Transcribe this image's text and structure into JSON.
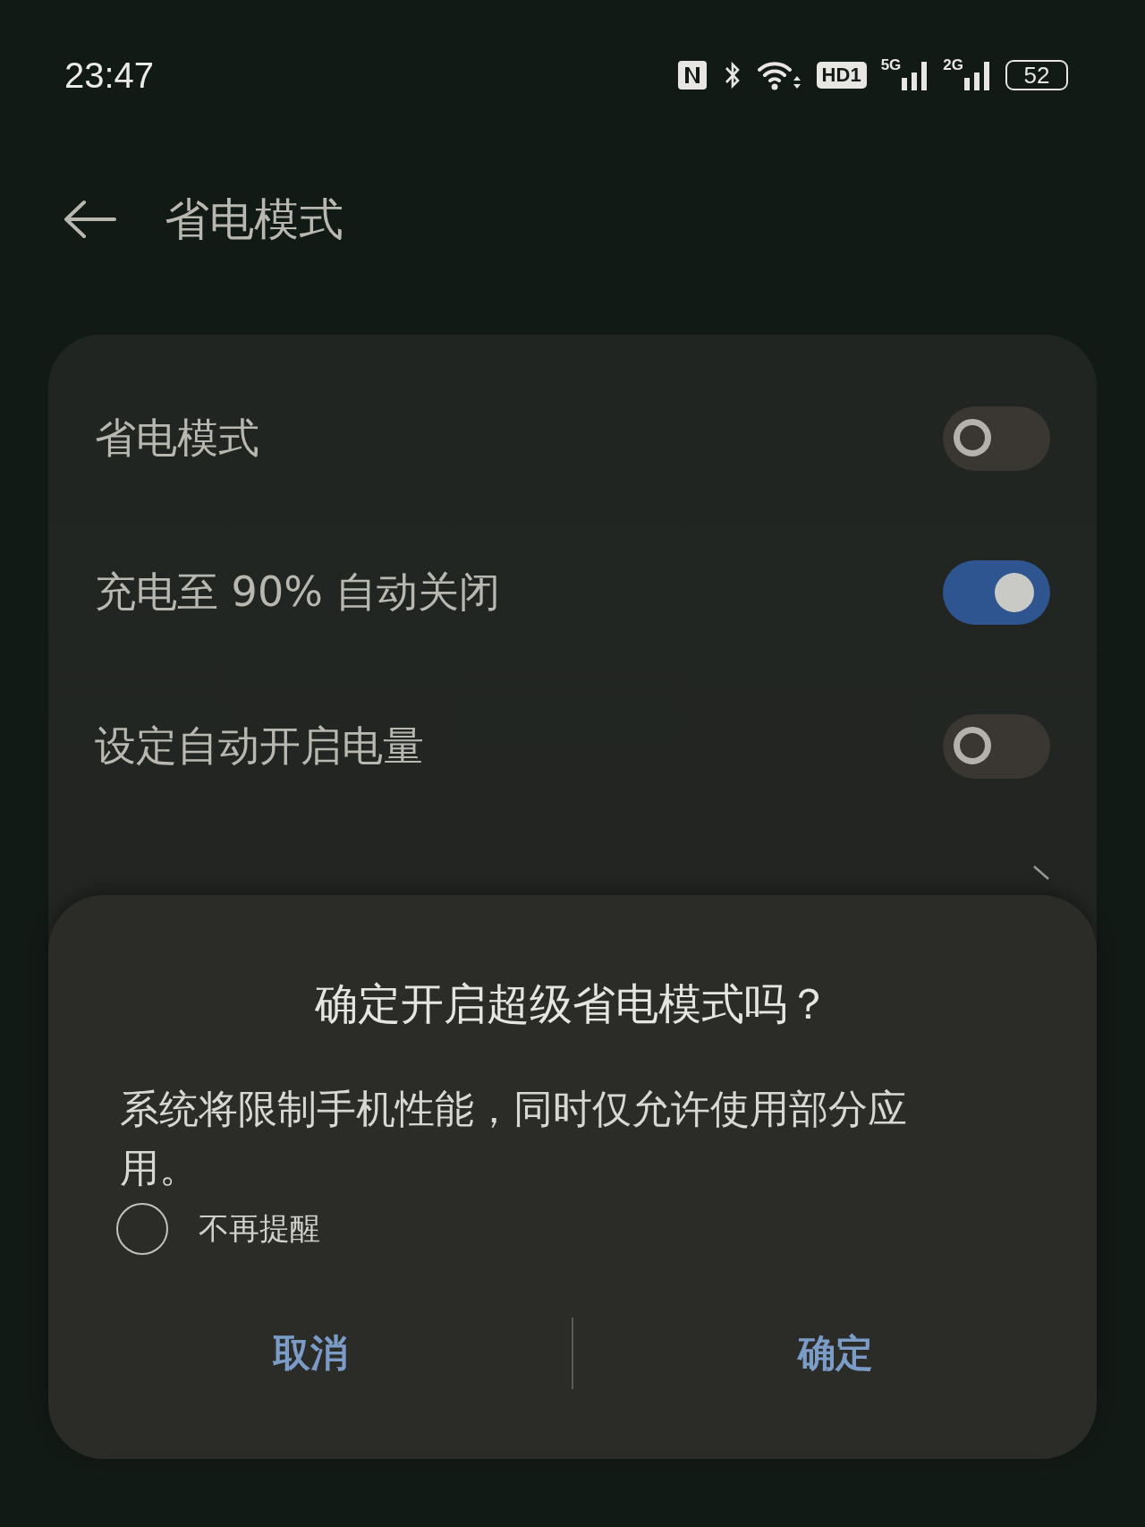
{
  "status_bar": {
    "time": "23:47",
    "hd_badge": "HD1",
    "network_1": "5G",
    "network_2": "2G",
    "battery": "52"
  },
  "header": {
    "title": "省电模式"
  },
  "settings": [
    {
      "kind": "toggle",
      "label": "省电模式",
      "on": false
    },
    {
      "kind": "toggle",
      "label": "充电至 90% 自动关闭",
      "on": true
    },
    {
      "kind": "toggle",
      "label": "设定自动开启电量",
      "on": false
    },
    {
      "kind": "link"
    }
  ],
  "dialog": {
    "title": "确定开启超级省电模式吗？",
    "message": "系统将限制手机性能，同时仅允许使用部分应用。",
    "checkbox": {
      "label": "不再提醒",
      "checked": false
    },
    "buttons": [
      "取消",
      "确定"
    ]
  }
}
